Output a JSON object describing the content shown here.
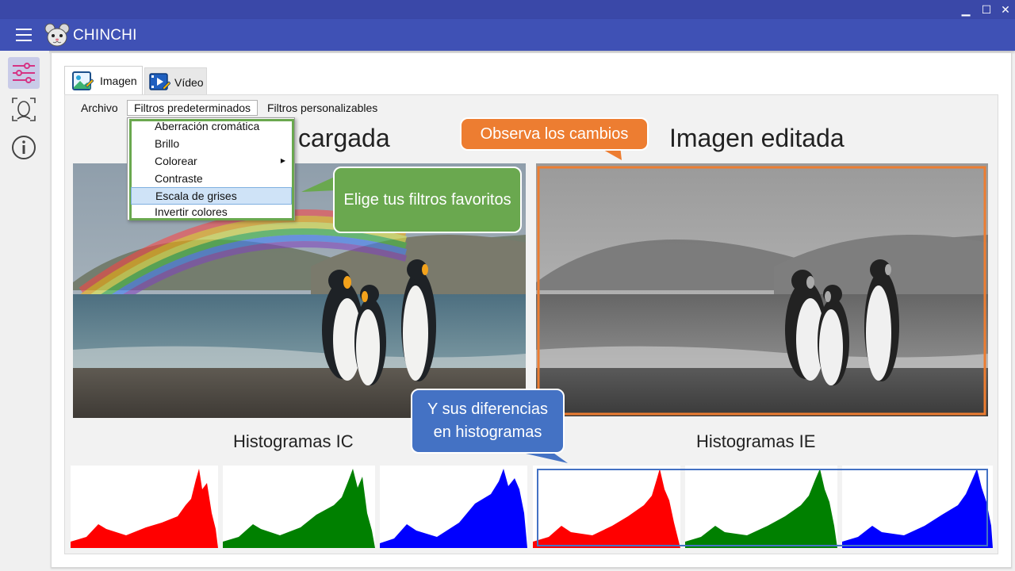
{
  "app": {
    "title": "CHINCHI"
  },
  "window_controls": {
    "minimize": "▁",
    "maximize": "☐",
    "close": "✕"
  },
  "tabs": [
    {
      "label": "Imagen",
      "active": true
    },
    {
      "label": "Vídeo",
      "active": false
    }
  ],
  "menubar": {
    "items": [
      {
        "label": "Archivo"
      },
      {
        "label": "Filtros predeterminados",
        "open": true
      },
      {
        "label": "Filtros personalizables"
      }
    ]
  },
  "dropdown": {
    "items": [
      {
        "label": "Aberración cromática"
      },
      {
        "label": "Brillo"
      },
      {
        "label": "Colorear",
        "submenu": true
      },
      {
        "label": "Contraste"
      },
      {
        "label": "Escala de grises",
        "selected": true
      },
      {
        "label": "Invertir colores"
      }
    ]
  },
  "sections": {
    "loaded_title": "cargada",
    "edited_title": "Imagen editada",
    "hist_loaded_title": "Histogramas IC",
    "hist_edited_title": "Histogramas IE"
  },
  "callouts": {
    "filters": "Elige tus filtros favoritos",
    "changes": "Observa los cambios",
    "histograms": "Y sus diferencias en histogramas"
  },
  "colors": {
    "accent": "#3f51b5",
    "green_callout": "#6aa84f",
    "orange_callout": "#ed7d31",
    "blue_callout": "#4472c4",
    "red_hist": "#ff0000",
    "green_hist": "#008000",
    "blue_hist": "#0000ff"
  },
  "icons": {
    "sidebar": [
      "sliders-icon",
      "face-scan-icon",
      "info-icon"
    ],
    "tabs": [
      "image-edit-icon",
      "video-edit-icon"
    ]
  }
}
